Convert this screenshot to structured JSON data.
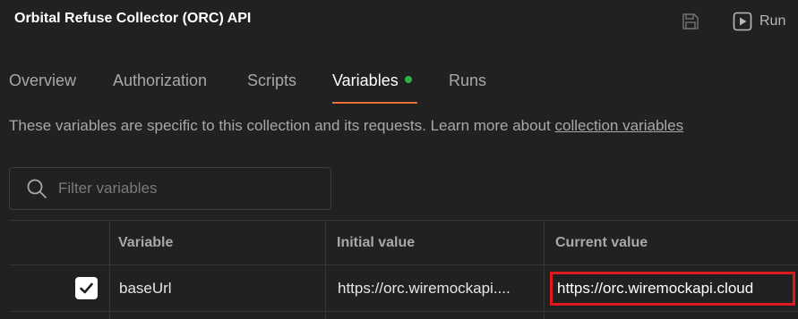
{
  "header": {
    "title": "Orbital Refuse Collector (ORC) API",
    "save_icon": "save-icon",
    "run_label": "Run",
    "run_icon": "play-icon"
  },
  "tabs": [
    {
      "label": "Overview",
      "active": false
    },
    {
      "label": "Authorization",
      "active": false
    },
    {
      "label": "Scripts",
      "active": false
    },
    {
      "label": "Variables",
      "active": true,
      "indicator_color": "#2fb14a"
    },
    {
      "label": "Runs",
      "active": false
    }
  ],
  "description": {
    "text": "These variables are specific to this collection and its requests. Learn more about ",
    "link": "collection variables"
  },
  "filter": {
    "placeholder": "Filter variables",
    "icon": "search-icon"
  },
  "table": {
    "columns": [
      "Variable",
      "Initial value",
      "Current value"
    ],
    "rows": [
      {
        "checked": true,
        "variable": "baseUrl",
        "initial_value": "https://orc.wiremockapi....",
        "current_value": "https://orc.wiremockapi.cloud"
      }
    ]
  },
  "colors": {
    "background": "#212121",
    "accent": "#f26b3a",
    "highlight": "#e0181f",
    "status_dot": "#2fb14a"
  }
}
